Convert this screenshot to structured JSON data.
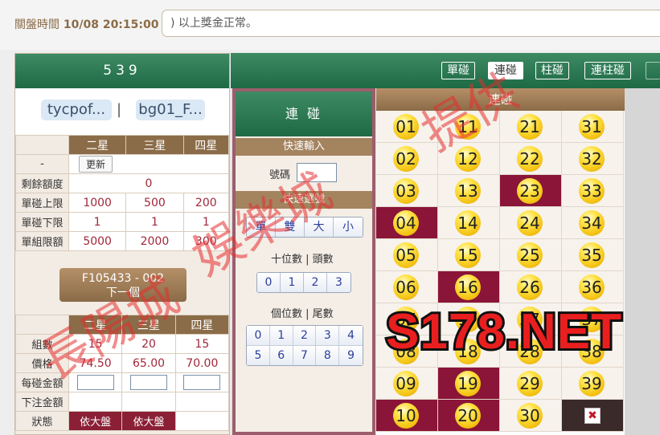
{
  "top": {
    "close_label": "關盤時間",
    "close_time": "10/08 20:15:00",
    "marquee_text": ") 以上獎金正常。"
  },
  "left": {
    "game_title": "539",
    "account1": "tycpof...",
    "separator": "|",
    "account2": "bg01_F...",
    "limit_table": {
      "headers": [
        "二星",
        "三星",
        "四星"
      ],
      "dash": "-",
      "update_label": "更新",
      "remaining_label": "剩餘額度",
      "remaining_value": "0",
      "rows": [
        {
          "label": "單碰上限",
          "values": [
            "1000",
            "500",
            "200"
          ]
        },
        {
          "label": "單碰下限",
          "values": [
            "1",
            "1",
            "1"
          ]
        },
        {
          "label": "單組限額",
          "values": [
            "5000",
            "2000",
            "300"
          ]
        }
      ]
    },
    "next_button": {
      "line1": "F105433 - 002",
      "line2": "下一個"
    },
    "bet_table": {
      "headers": [
        "二星",
        "三星",
        "四星"
      ],
      "groups_label": "組數",
      "groups": [
        "15",
        "20",
        "15"
      ],
      "price_label": "價格",
      "prices": [
        "74.50",
        "65.00",
        "70.00"
      ],
      "per_bet_label": "每碰金額",
      "total_label": "下注金額",
      "status_label": "狀態",
      "status_values": [
        "依大盤",
        "依大盤"
      ]
    }
  },
  "tabs": [
    "單碰",
    "連碰",
    "柱碰",
    "連柱碰"
  ],
  "active_tab": "連碰",
  "quick": {
    "title": "連 碰",
    "quick_input_header": "快速輸入",
    "number_label": "號碼",
    "quick_select_header": "快速選號",
    "odd_even_buttons": [
      "單",
      "雙",
      "大",
      "小"
    ],
    "tens_label": "十位數 | 頭數",
    "tens_buttons": [
      "0",
      "1",
      "2",
      "3"
    ],
    "units_label": "個位數 | 尾數",
    "units_buttons": [
      "0",
      "1",
      "2",
      "3",
      "4",
      "5",
      "6",
      "7",
      "8",
      "9"
    ]
  },
  "balls": {
    "header": "連碰",
    "selected": [
      "04",
      "10",
      "16",
      "19",
      "20",
      "23"
    ],
    "numbers": [
      "01",
      "02",
      "03",
      "04",
      "05",
      "06",
      "07",
      "08",
      "09",
      "10",
      "11",
      "12",
      "13",
      "14",
      "15",
      "16",
      "17",
      "18",
      "19",
      "20",
      "21",
      "22",
      "23",
      "24",
      "25",
      "26",
      "27",
      "28",
      "29",
      "30",
      "31",
      "32",
      "33",
      "34",
      "35",
      "36",
      "37",
      "38",
      "39"
    ],
    "clear_icon": "✖"
  },
  "overlay": {
    "site": "S178.NET",
    "watermark": "長陽城娛樂城提供"
  },
  "colors": {
    "brand_green": "#1e6a45",
    "brown": "#8b6c48",
    "selected_maroon": "#8a1538",
    "ball_yellow": "#f4c213",
    "value_red": "#a1283a"
  }
}
